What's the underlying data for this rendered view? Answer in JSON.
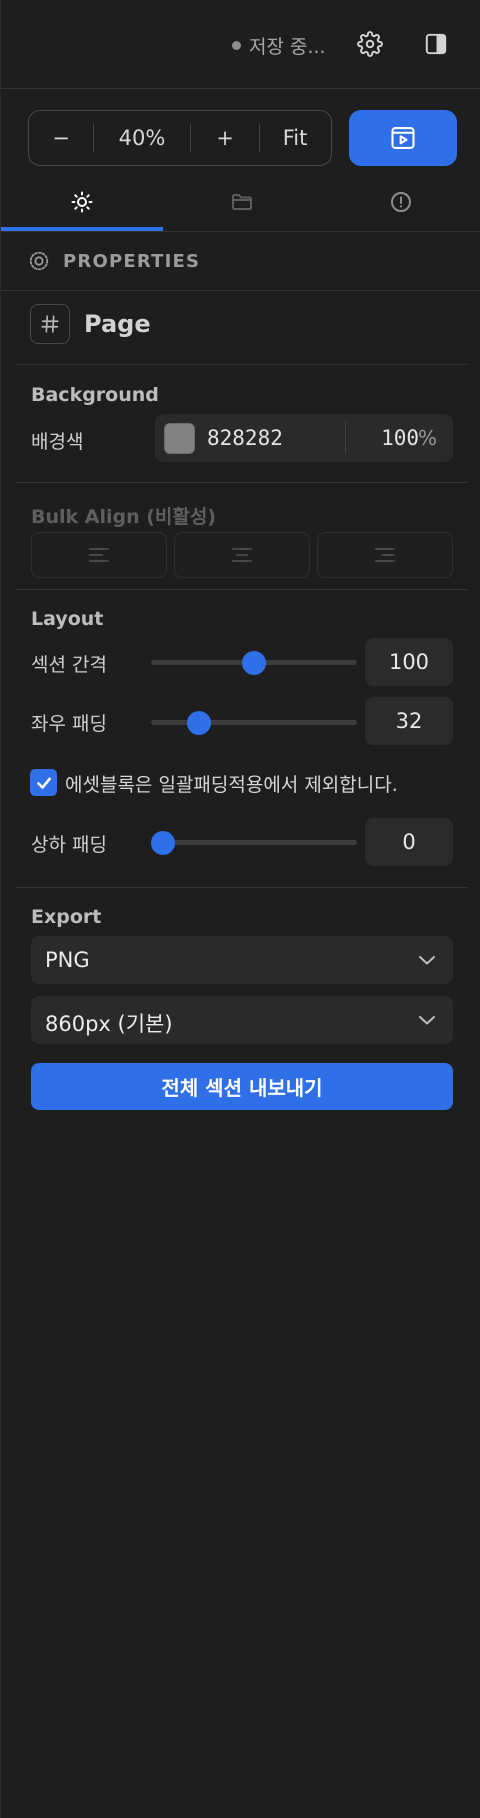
{
  "header": {
    "save_status": "저장 중...",
    "icons": [
      "settings-gear-icon",
      "panel-toggle-icon"
    ]
  },
  "zoom": {
    "minus": "−",
    "value": "40%",
    "plus": "+",
    "fit": "Fit"
  },
  "tabs": [
    {
      "icon": "sun-settings-icon",
      "active": true
    },
    {
      "icon": "folder-icon",
      "active": false
    },
    {
      "icon": "info-circle-icon",
      "active": false
    }
  ],
  "properties": {
    "title": "PROPERTIES",
    "page_label": "Page"
  },
  "background": {
    "title": "Background",
    "color_label": "배경색",
    "hex": "828282",
    "swatch": "#828282",
    "opacity": "100",
    "opacity_unit": "%"
  },
  "bulk_align": {
    "title": "Bulk Align (비활성)",
    "disabled": true,
    "options": [
      "align-left-icon",
      "align-center-icon",
      "align-right-icon"
    ]
  },
  "layout": {
    "title": "Layout",
    "section_gap": {
      "label": "섹션 간격",
      "value": "100",
      "fraction": 0.5
    },
    "horizontal_padding": {
      "label": "좌우 패딩",
      "value": "32",
      "fraction": 0.2
    },
    "exclude_checkbox": {
      "label": "에셋블록은 일괄패딩적용에서 제외합니다.",
      "checked": true
    },
    "vertical_padding": {
      "label": "상하 패딩",
      "value": "0",
      "fraction": 0.0
    }
  },
  "export": {
    "title": "Export",
    "format": "PNG",
    "width": "860px (기본)",
    "button": "전체 섹션 내보내기"
  },
  "colors": {
    "accent": "#2f6fe8",
    "background": "#1e1e1e",
    "field": "#2a2a2a"
  }
}
